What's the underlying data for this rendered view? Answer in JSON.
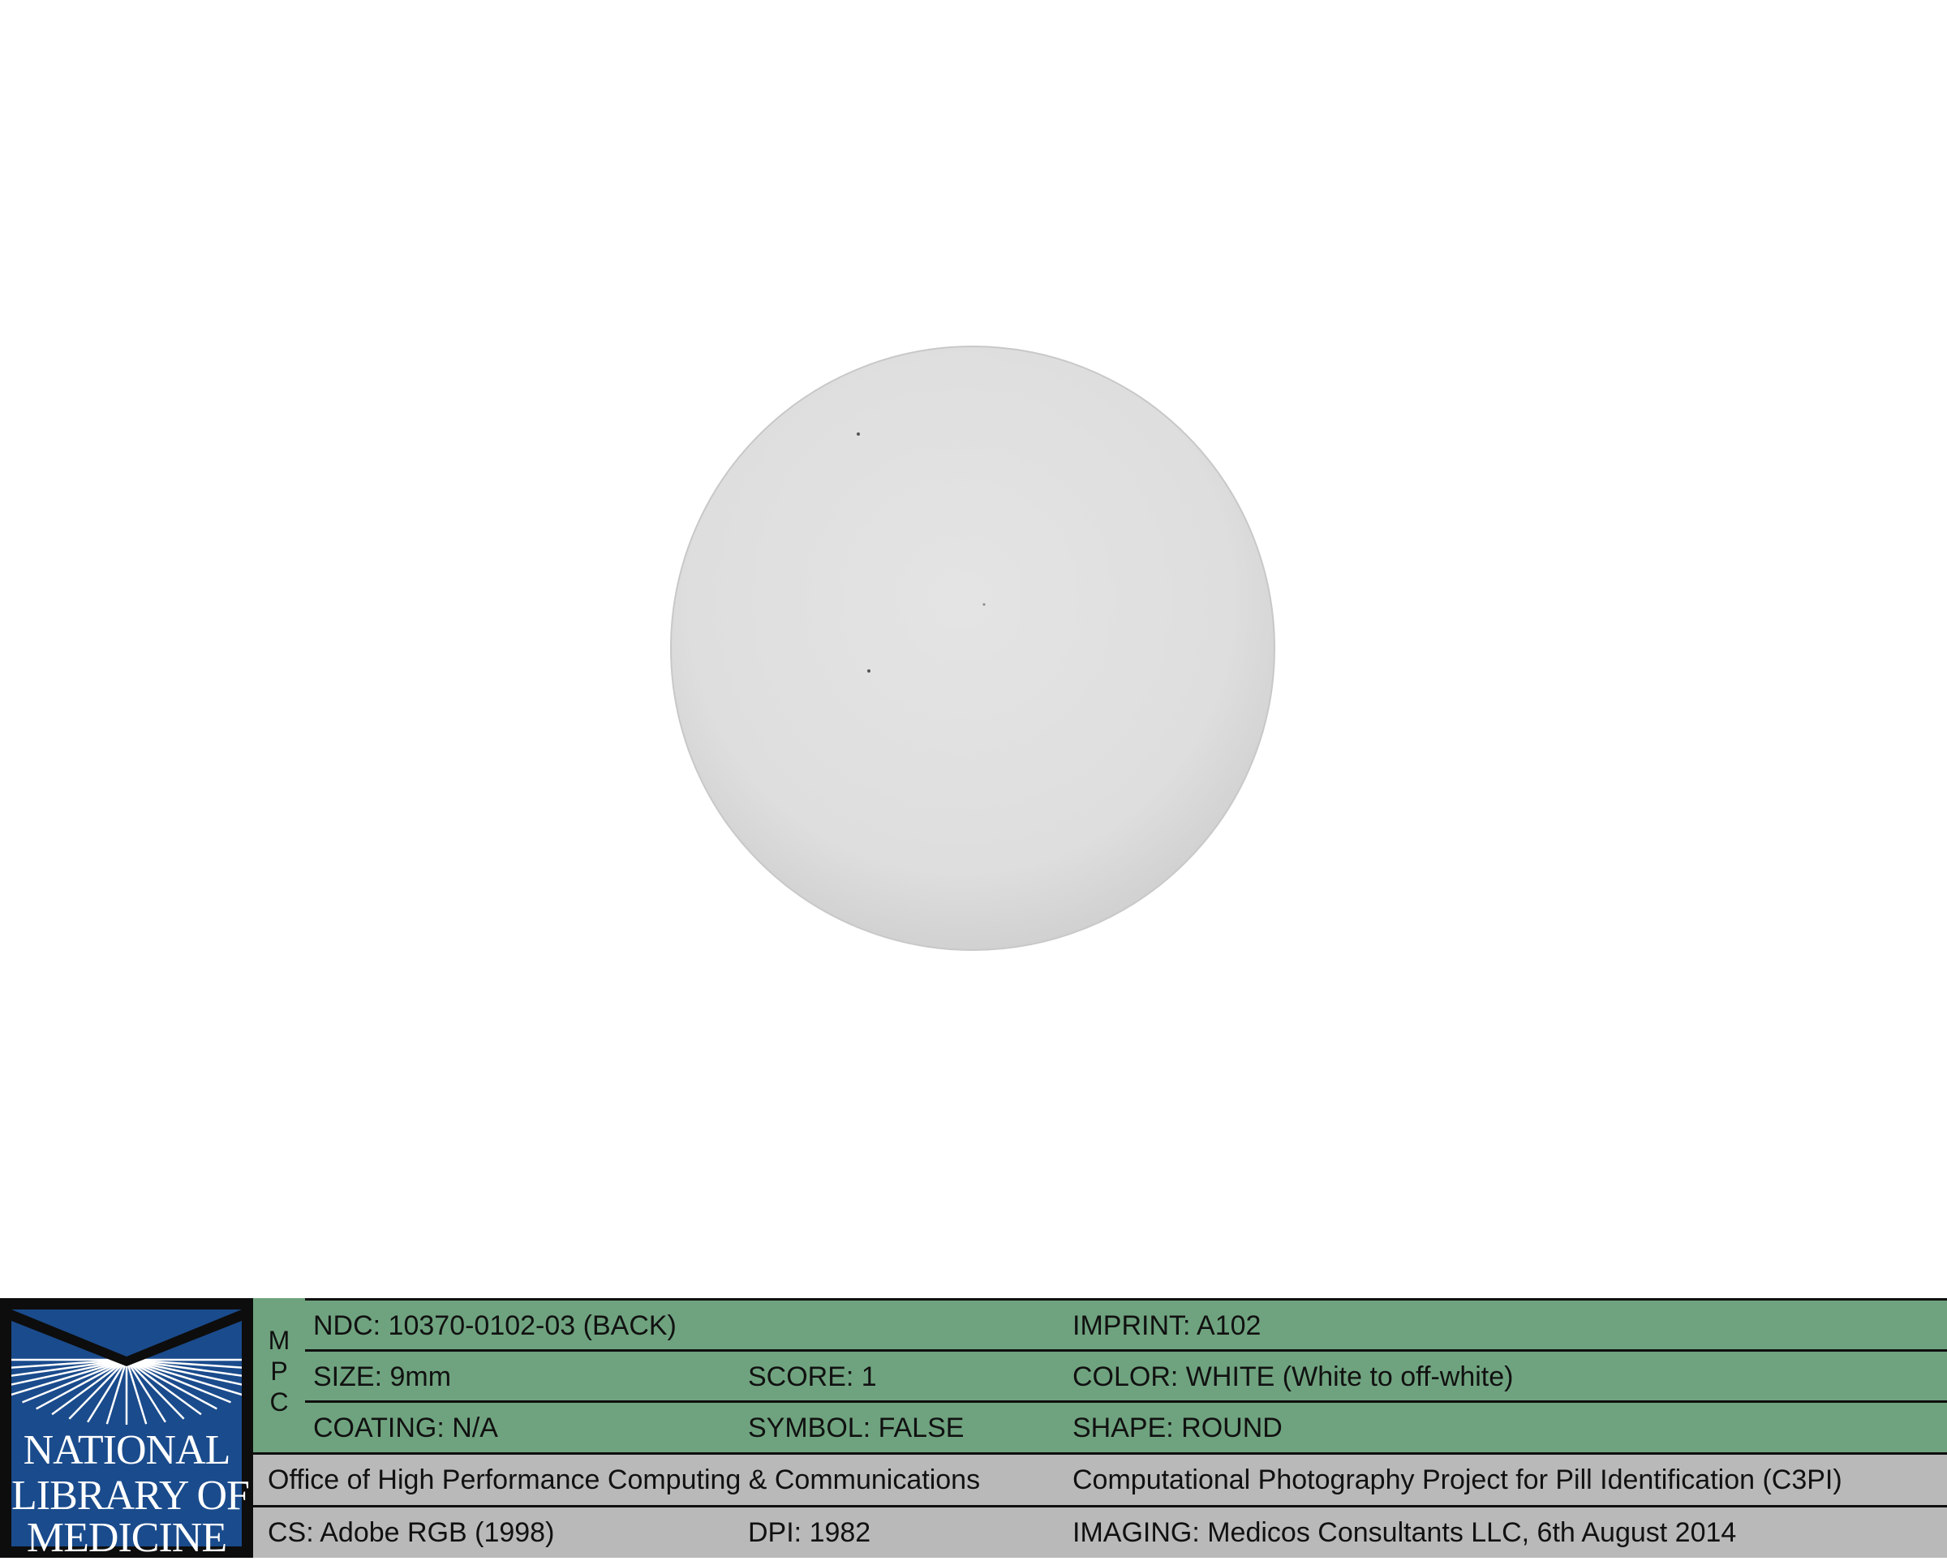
{
  "photo": {
    "subject": "pill",
    "pill_color": "#e2e2e2",
    "background_color": "#ffffff"
  },
  "logo": {
    "line1": "NATIONAL",
    "line2": "LIBRARY OF",
    "line3": "MEDICINE",
    "colors": {
      "frame": "#0d0d0d",
      "box": "#1a4b8c",
      "text": "#ffffff"
    }
  },
  "mpc": {
    "m": "M",
    "p": "P",
    "c": "C"
  },
  "info": {
    "ndc": "NDC: 10370-0102-03 (BACK)",
    "imprint": "IMPRINT: A102",
    "size": "SIZE: 9mm",
    "score": "SCORE: 1",
    "color": "COLOR: WHITE (White to off-white)",
    "coating": "COATING: N/A",
    "symbol": "SYMBOL: FALSE",
    "shape": "SHAPE: ROUND"
  },
  "footer": {
    "office": "Office of High Performance Computing & Communications",
    "project": "Computational Photography Project for Pill Identification (C3PI)",
    "cs": "CS: Adobe RGB (1998)",
    "dpi": "DPI: 1982",
    "imaging": "IMAGING: Medicos Consultants LLC, 6th August 2014"
  },
  "colors": {
    "green_band": "#6fa37f",
    "gray_band": "#b9b9b9",
    "divider": "#0f0f0f"
  }
}
